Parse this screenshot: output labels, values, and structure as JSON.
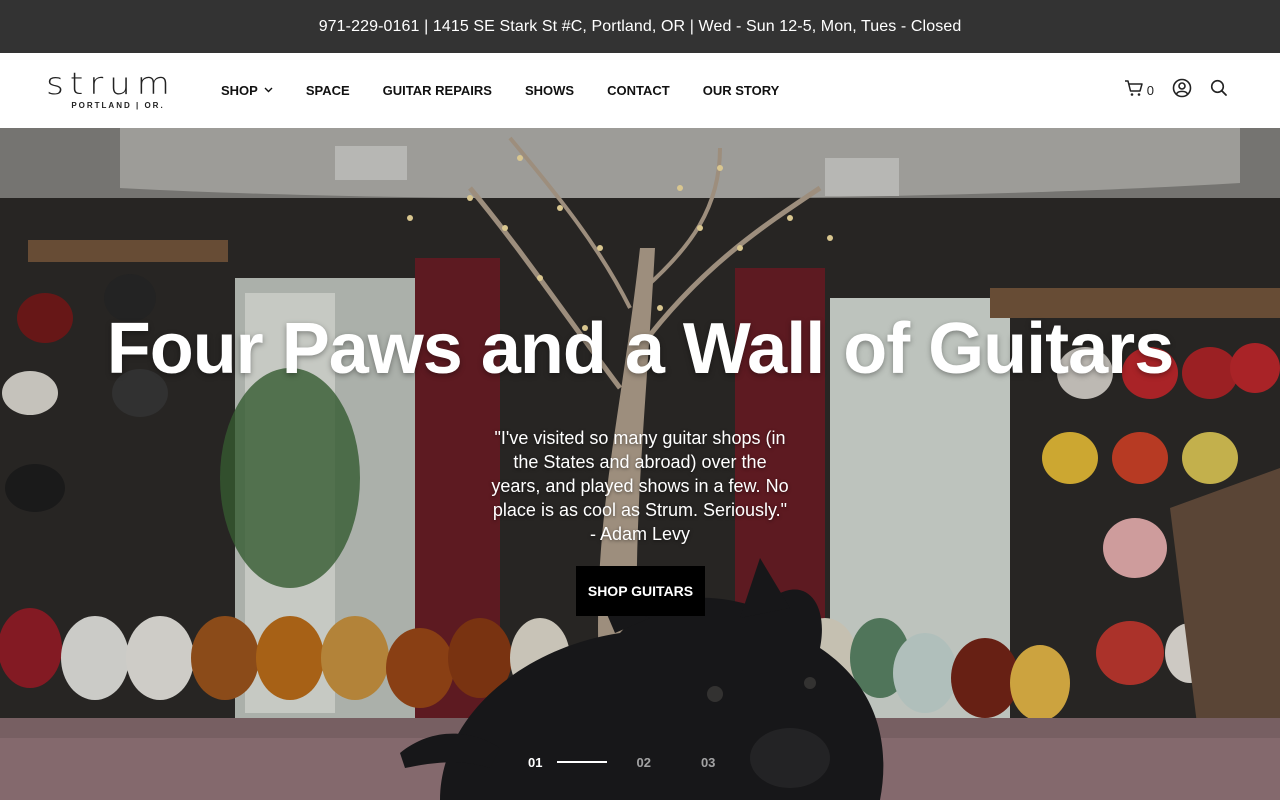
{
  "topbar": {
    "text": "971-229-0161 | 1415 SE Stark St #C, Portland, OR | Wed - Sun 12-5, Mon, Tues - Closed"
  },
  "header": {
    "logo_word": "strum",
    "logo_sub": "PORTLAND | OR.",
    "nav": [
      {
        "label": "SHOP",
        "has_dropdown": true
      },
      {
        "label": "SPACE"
      },
      {
        "label": "GUITAR REPAIRS"
      },
      {
        "label": "SHOWS"
      },
      {
        "label": "CONTACT"
      },
      {
        "label": "OUR STORY"
      }
    ],
    "cart_count": "0",
    "icons": [
      "cart-icon",
      "account-icon",
      "search-icon"
    ]
  },
  "hero": {
    "title": "Four Paws and a Wall of Guitars",
    "quote": "\"I've visited so many guitar shops (in the States and abroad) over the years, and played shows in a few. No place is as cool as Strum. Seriously.\" - Adam Levy",
    "button_label": "SHOP GUITARS",
    "slides": [
      "01",
      "02",
      "03"
    ],
    "active_slide": "01"
  },
  "colors": {
    "topbar_bg": "#333333",
    "button_bg": "#000000",
    "text_light": "#ffffff"
  }
}
